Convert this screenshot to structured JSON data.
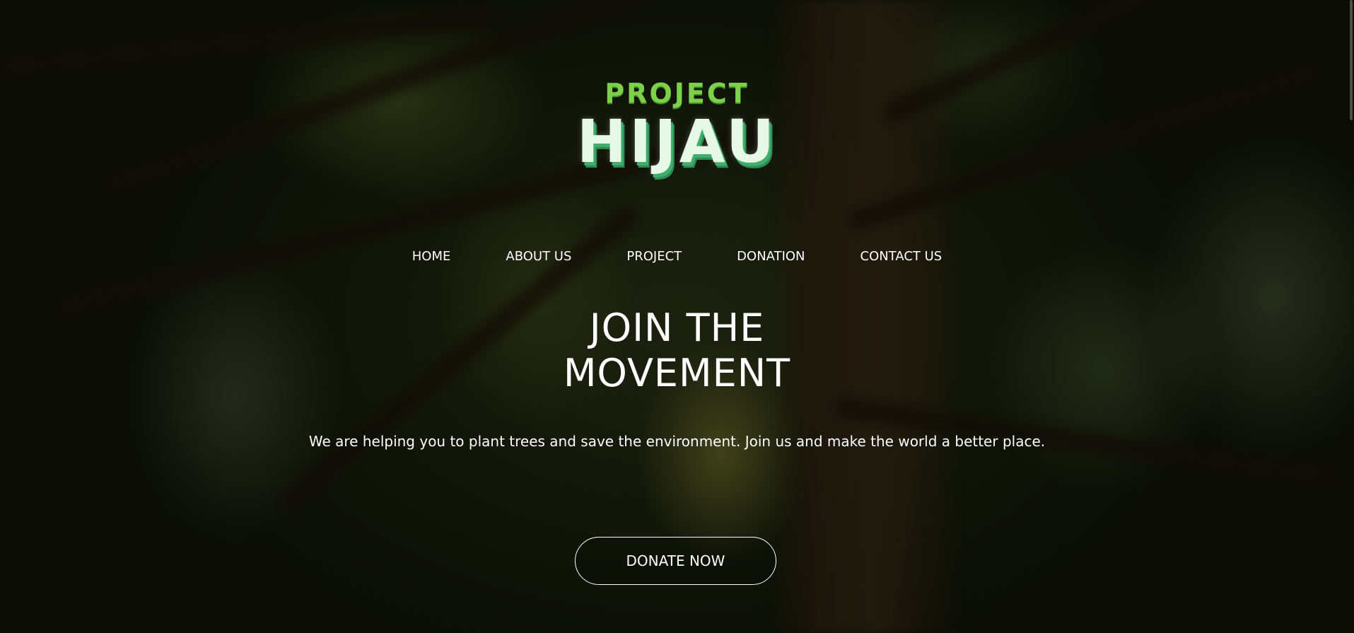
{
  "logo": {
    "top_text": "PROJECT",
    "main_text": "HIJAU"
  },
  "nav": {
    "items": [
      {
        "label": "HOME"
      },
      {
        "label": "ABOUT US"
      },
      {
        "label": "PROJECT"
      },
      {
        "label": "DONATION"
      },
      {
        "label": "CONTACT US"
      }
    ]
  },
  "hero": {
    "headline_line1": "JOIN THE",
    "headline_line2": "MOVEMENT",
    "subtext": "We are helping you to plant trees and save the environment. Join us and make the world a better place.",
    "cta_label": "DONATE NOW"
  },
  "colors": {
    "logo_green": "#7ed04b",
    "logo_mint": "#e6f8e6",
    "logo_shadow": "#3fae6a",
    "text": "#ffffff"
  }
}
